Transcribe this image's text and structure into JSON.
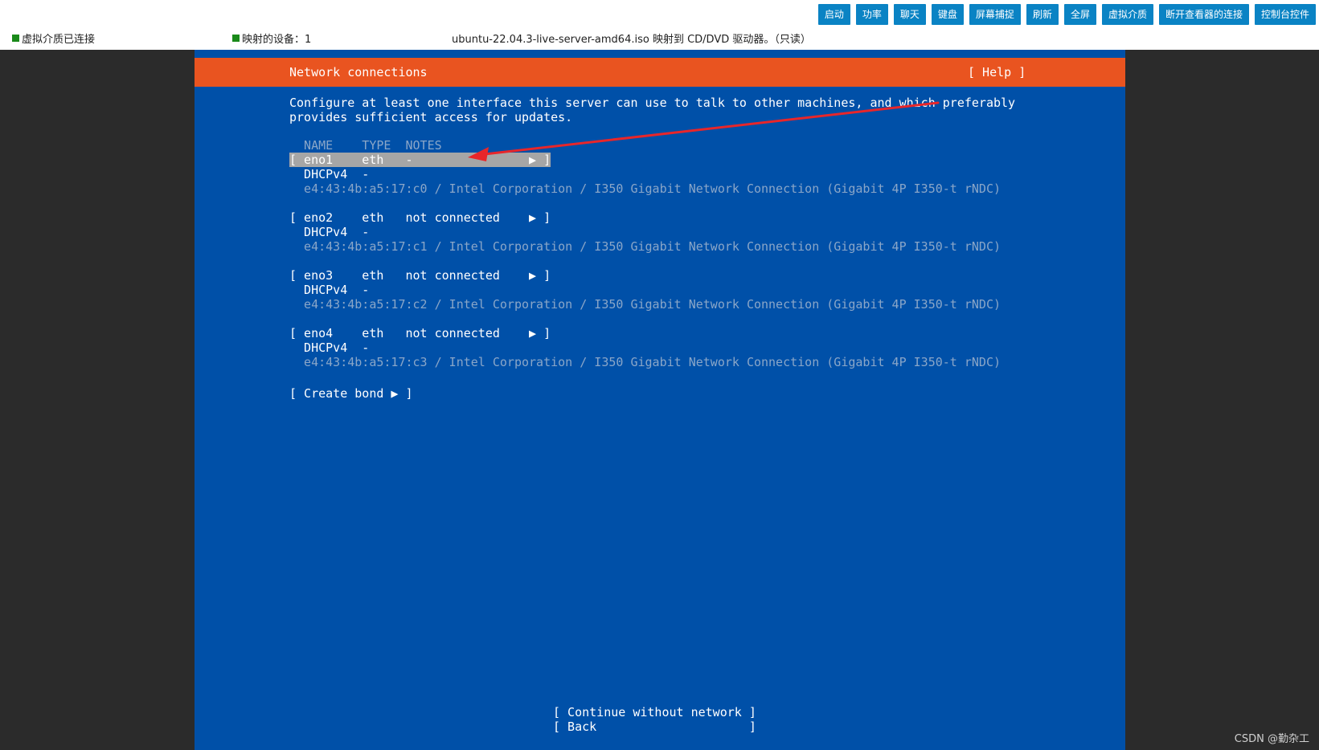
{
  "toolbar": {
    "buttons": [
      "启动",
      "功率",
      "聊天",
      "键盘",
      "屏幕捕捉",
      "刷新",
      "全屏",
      "虚拟介质",
      "断开查看器的连接",
      "控制台控件"
    ],
    "button_color": "#0a83c4"
  },
  "status": {
    "media_connected": "虚拟介质已连接",
    "mapped_devices": "映射的设备：1",
    "iso_info": "ubuntu-22.04.3-live-server-amd64.iso 映射到 CD/DVD 驱动器。（只读）",
    "indicator_color": "#1a8a1a"
  },
  "console": {
    "title": "Network connections",
    "help": "[ Help ]",
    "description_line1": "Configure at least one interface this server can use to talk to other machines, and which preferably",
    "description_line2": "provides sufficient access for updates.",
    "header": "  NAME    TYPE  NOTES",
    "interfaces": [
      {
        "row": "[ eno1    eth   -                ▶ ]",
        "dhcp": "  DHCPv4  -",
        "detail": "  e4:43:4b:a5:17:c0 / Intel Corporation / I350 Gigabit Network Connection (Gigabit 4P I350-t rNDC)"
      },
      {
        "row": "[ eno2    eth   not connected    ▶ ]",
        "dhcp": "  DHCPv4  -",
        "detail": "  e4:43:4b:a5:17:c1 / Intel Corporation / I350 Gigabit Network Connection (Gigabit 4P I350-t rNDC)"
      },
      {
        "row": "[ eno3    eth   not connected    ▶ ]",
        "dhcp": "  DHCPv4  -",
        "detail": "  e4:43:4b:a5:17:c2 / Intel Corporation / I350 Gigabit Network Connection (Gigabit 4P I350-t rNDC)"
      },
      {
        "row": "[ eno4    eth   not connected    ▶ ]",
        "dhcp": "  DHCPv4  -",
        "detail": "  e4:43:4b:a5:17:c3 / Intel Corporation / I350 Gigabit Network Connection (Gigabit 4P I350-t rNDC)"
      }
    ],
    "create_bond": "[ Create bond ▶ ]",
    "continue_without_network": "[ Continue without network ]",
    "back": "[ Back                     ]",
    "background_color": "#0050a8",
    "title_bar_color": "#e95420",
    "annotation_arrow_color": "#e8262a"
  },
  "watermark": "CSDN @勤杂工"
}
